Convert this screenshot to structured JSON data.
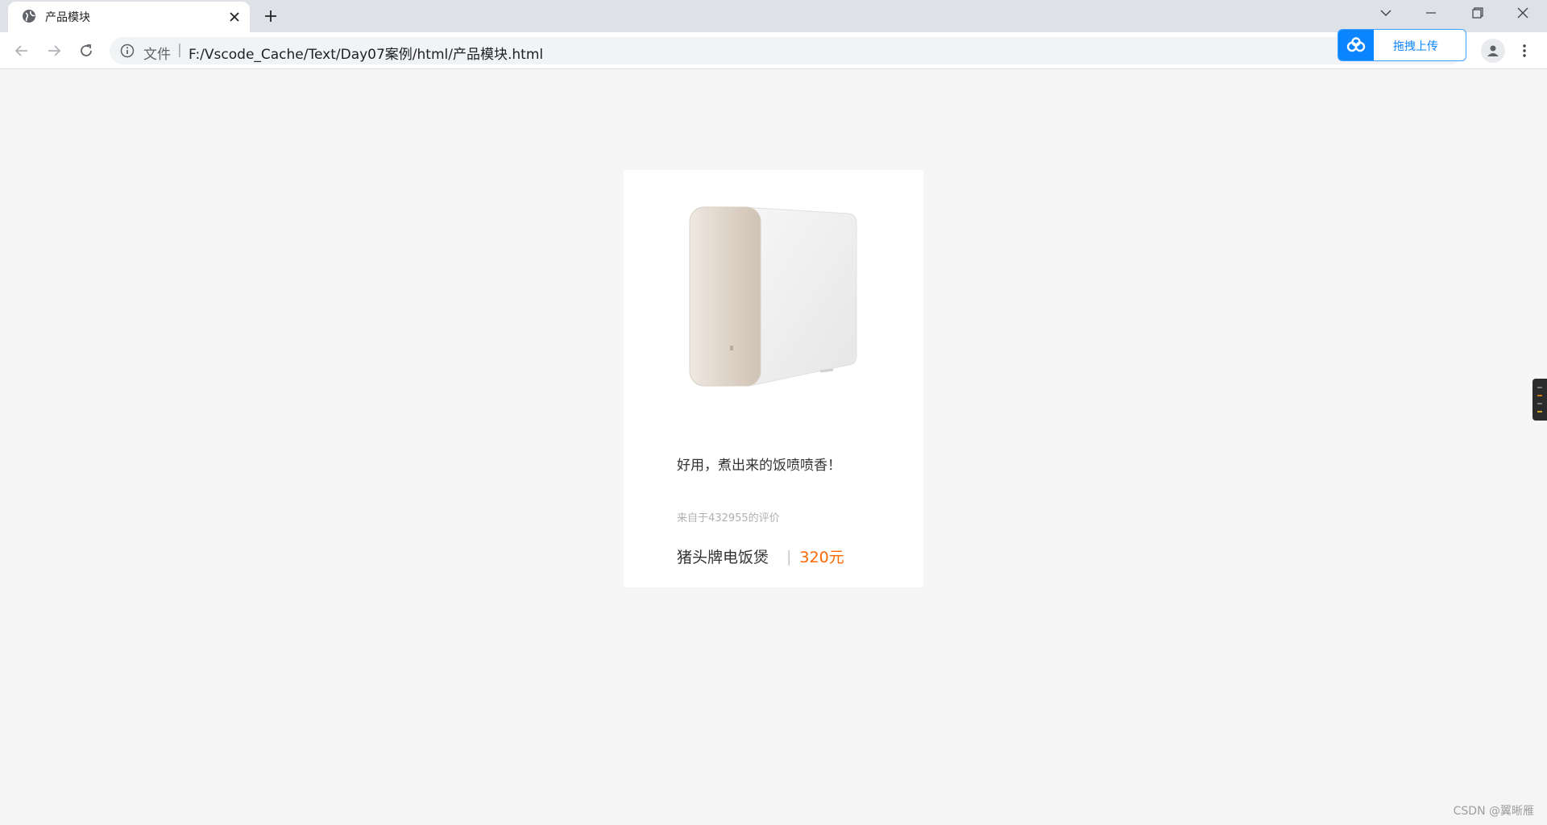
{
  "browser": {
    "tab_title": "产品模块",
    "url_scheme_label": "文件",
    "url_separator": "|",
    "url": "F:/Vscode_Cache/Text/Day07案例/html/产品模块.html",
    "extension_upload_label": "拖拽上传",
    "icons": {
      "favicon": "globe-icon",
      "close": "close-icon",
      "new_tab": "plus-icon",
      "back": "arrow-left-icon",
      "forward": "arrow-right-icon",
      "reload": "reload-icon",
      "info": "info-icon",
      "profile": "person-icon",
      "menu": "kebab-menu-icon",
      "tab_search": "chevron-down-icon",
      "minimize": "minimize-icon",
      "restore": "restore-icon",
      "window_close": "close-icon"
    }
  },
  "product": {
    "review": "好用，煮出来的饭喷喷香！",
    "review_source": "来自于432955的评价",
    "name": "猪头牌电饭煲",
    "divider": "|",
    "price": "320元"
  },
  "watermark": "CSDN @翼晰雁",
  "colors": {
    "page_bg": "#f5f5f5",
    "card_bg": "#ffffff",
    "price": "#ff6700",
    "muted_text": "#b0b0b0",
    "ext_accent": "#0b84ff"
  }
}
